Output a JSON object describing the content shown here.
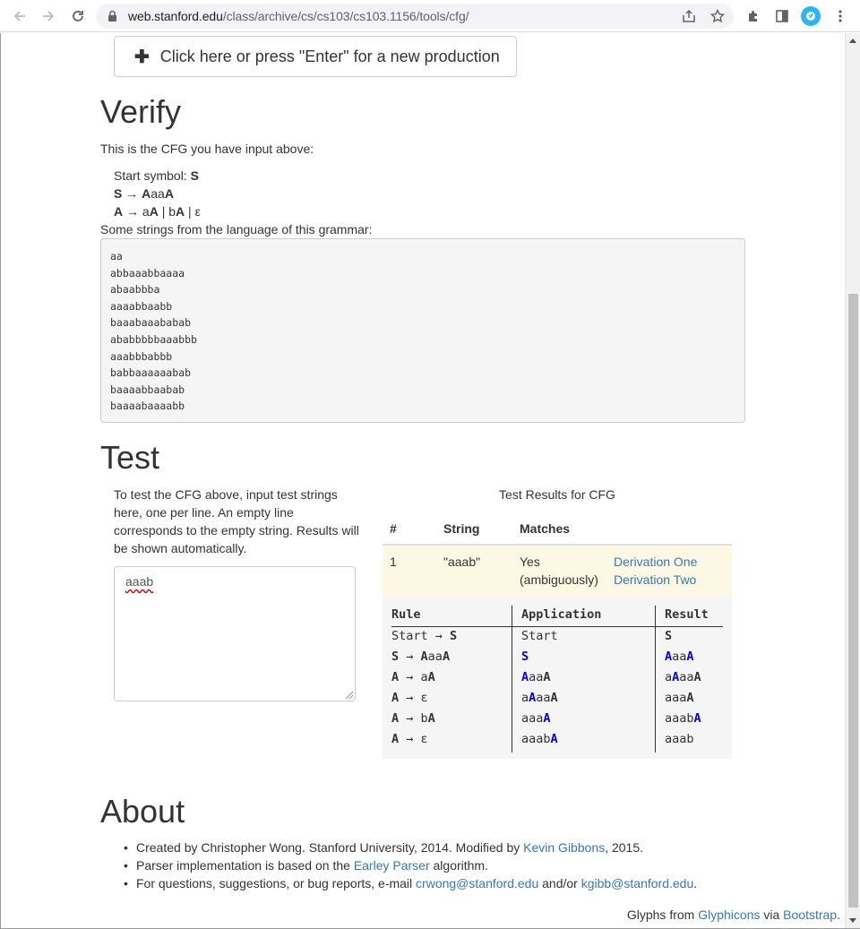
{
  "browser": {
    "url_host": "web.stanford.edu",
    "url_path": "/class/archive/cs/cs103/cs103.1156/tools/cfg/"
  },
  "production_button": {
    "icon": "plus-icon",
    "label": "Click here or press \"Enter\" for a new production"
  },
  "verify": {
    "heading": "Verify",
    "intro": "This is the CFG you have input above:",
    "start_label": "Start symbol: ",
    "start_symbol": "S",
    "rules": [
      {
        "lhs": "S",
        "arrow": " → ",
        "rhs": [
          {
            "t": "A",
            "nt": true
          },
          {
            "t": "aa",
            "nt": false
          },
          {
            "t": "A",
            "nt": true
          }
        ]
      },
      {
        "lhs": "A",
        "arrow": " → ",
        "rhs": [
          {
            "t": "a",
            "nt": false
          },
          {
            "t": "A",
            "nt": true
          },
          {
            "t": " | b",
            "nt": false
          },
          {
            "t": "A",
            "nt": true
          },
          {
            "t": " | ε",
            "nt": false
          }
        ]
      }
    ],
    "strings_label": "Some strings from the language of this grammar:",
    "strings": [
      "aa",
      "abbaaabbaaaa",
      "abaabbba",
      "aaaabbaabb",
      "baaabaaababab",
      "ababbbbbaaabbb",
      "aaabbbabbb",
      "babbaaaaaabab",
      "baaaabbaabab",
      "baaaabaaaabb"
    ]
  },
  "test": {
    "heading": "Test",
    "description": "To test the CFG above, input test strings here, one per line. An empty line corresponds to the empty string. Results will be shown automatically.",
    "input_value": "aaab",
    "results_caption": "Test Results for CFG",
    "columns": [
      "#",
      "String",
      "Matches"
    ],
    "row": {
      "num": "1",
      "string": "\"aaab\"",
      "matches_line1": "Yes",
      "matches_line2": "(ambiguously)",
      "link1": "Derivation One",
      "link2": "Derivation Two"
    },
    "derivation": {
      "headers": [
        "Rule",
        "Application",
        "Result"
      ]
    }
  },
  "about": {
    "heading": "About",
    "item1_a": "Created by Christopher Wong. Stanford University, 2014. Modified by ",
    "item1_link": "Kevin Gibbons",
    "item1_b": ", 2015.",
    "item2_a": "Parser implementation is based on the ",
    "item2_link": "Earley Parser",
    "item2_b": " algorithm.",
    "item3_a": "For questions, suggestions, or bug reports, e-mail ",
    "item3_link1": "crwong@stanford.edu",
    "item3_mid": " and/or ",
    "item3_link2": "kgibb@stanford.edu",
    "item3_b": "."
  },
  "footer": {
    "a": "Glyphs from ",
    "link1": "Glyphicons",
    "mid": " via ",
    "link2": "Bootstrap",
    "b": "."
  }
}
